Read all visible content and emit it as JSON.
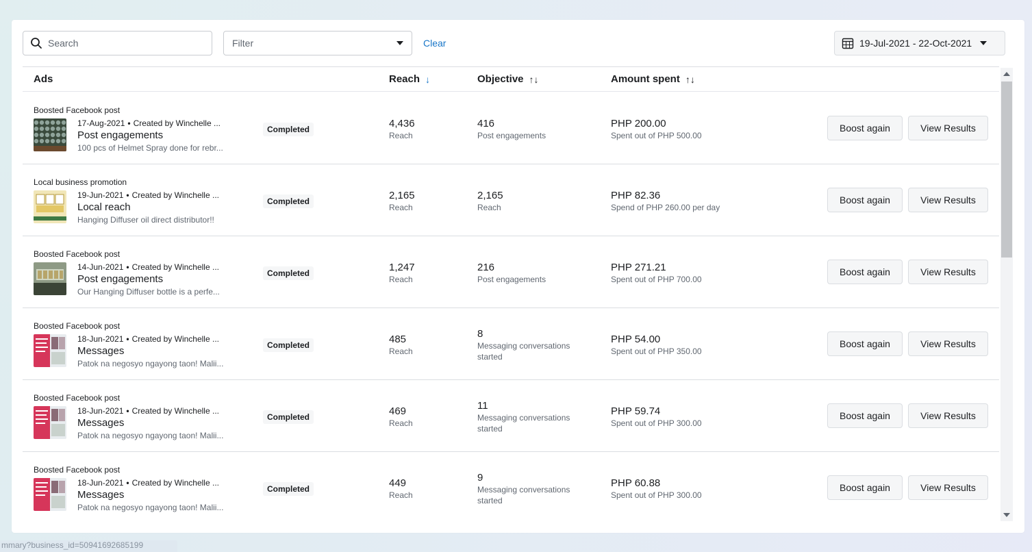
{
  "toolbar": {
    "search_placeholder": "Search",
    "filter_placeholder": "Filter",
    "clear_label": "Clear",
    "date_range": "19-Jul-2021 - 22-Oct-2021"
  },
  "columns": {
    "ads": "Ads",
    "reach": "Reach",
    "objective": "Objective",
    "amount_spent": "Amount spent",
    "reach_sort": "↓",
    "objective_sort": "↑↓",
    "amount_sort": "↑↓"
  },
  "rows": [
    {
      "type": "Boosted Facebook post",
      "date": "17-Aug-2021",
      "creator": "Created by Winchelle ...",
      "name": "Post engagements",
      "description": "100 pcs of Helmet Spray done for rebr...",
      "status": "Completed",
      "reach": "4,436",
      "reach_label": "Reach",
      "objective_value": "416",
      "objective_label": "Post engagements",
      "amount": "PHP 200.00",
      "amount_note": "Spent out of PHP 500.00",
      "boost_label": "Boost again",
      "view_label": "View Results"
    },
    {
      "type": "Local business promotion",
      "date": "19-Jun-2021",
      "creator": "Created by Winchelle ...",
      "name": "Local reach",
      "description": "Hanging Diffuser oil direct distributor!!",
      "status": "Completed",
      "reach": "2,165",
      "reach_label": "Reach",
      "objective_value": "2,165",
      "objective_label": "Reach",
      "amount": "PHP 82.36",
      "amount_note": "Spend of PHP 260.00 per day",
      "boost_label": "Boost again",
      "view_label": "View Results"
    },
    {
      "type": "Boosted Facebook post",
      "date": "14-Jun-2021",
      "creator": "Created by Winchelle ...",
      "name": "Post engagements",
      "description": "Our Hanging Diffuser bottle is a perfe...",
      "status": "Completed",
      "reach": "1,247",
      "reach_label": "Reach",
      "objective_value": "216",
      "objective_label": "Post engagements",
      "amount": "PHP 271.21",
      "amount_note": "Spent out of PHP 700.00",
      "boost_label": "Boost again",
      "view_label": "View Results"
    },
    {
      "type": "Boosted Facebook post",
      "date": "18-Jun-2021",
      "creator": "Created by Winchelle ...",
      "name": "Messages",
      "description": "Patok na negosyo ngayong taon! Malii...",
      "status": "Completed",
      "reach": "485",
      "reach_label": "Reach",
      "objective_value": "8",
      "objective_label": "Messaging conversations started",
      "amount": "PHP 54.00",
      "amount_note": "Spent out of PHP 350.00",
      "boost_label": "Boost again",
      "view_label": "View Results"
    },
    {
      "type": "Boosted Facebook post",
      "date": "18-Jun-2021",
      "creator": "Created by Winchelle ...",
      "name": "Messages",
      "description": "Patok na negosyo ngayong taon! Malii...",
      "status": "Completed",
      "reach": "469",
      "reach_label": "Reach",
      "objective_value": "11",
      "objective_label": "Messaging conversations started",
      "amount": "PHP 59.74",
      "amount_note": "Spent out of PHP 300.00",
      "boost_label": "Boost again",
      "view_label": "View Results"
    },
    {
      "type": "Boosted Facebook post",
      "date": "18-Jun-2021",
      "creator": "Created by Winchelle ...",
      "name": "Messages",
      "description": "Patok na negosyo ngayong taon! Malii...",
      "status": "Completed",
      "reach": "449",
      "reach_label": "Reach",
      "objective_value": "9",
      "objective_label": "Messaging conversations started",
      "amount": "PHP 60.88",
      "amount_note": "Spent out of PHP 300.00",
      "boost_label": "Boost again",
      "view_label": "View Results"
    }
  ],
  "status_bar": {
    "url": "mmary?business_id=509416926851​99"
  },
  "colors": {
    "accent": "#1876c8",
    "border": "#dadde1",
    "button_bg": "#f5f6f7"
  }
}
